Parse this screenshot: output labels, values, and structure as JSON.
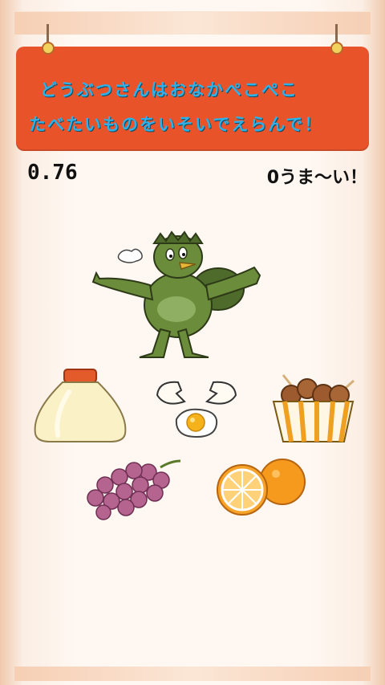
{
  "sign": {
    "line1": "どうぶつさんはおなかぺこぺこ",
    "line2": "たべたいものをいそいでえらんで！"
  },
  "status": {
    "timer": "0.76",
    "praise": "0うま〜い！"
  },
  "foods": [
    {
      "id": "mayonnaise"
    },
    {
      "id": "egg"
    },
    {
      "id": "karaage"
    },
    {
      "id": "grapes"
    },
    {
      "id": "orange"
    }
  ],
  "colors": {
    "sign_bg": "#e8532a",
    "sign_text": "#2db1e8",
    "kappa_green": "#6b8c3a"
  }
}
